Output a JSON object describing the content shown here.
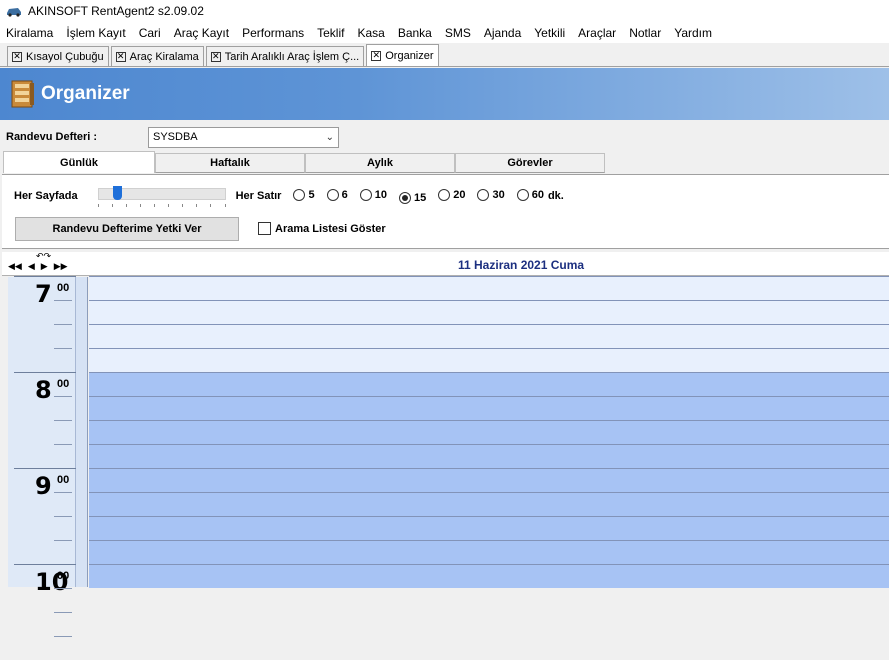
{
  "window": {
    "title": "AKINSOFT RentAgent2 s2.09.02"
  },
  "menu": [
    "Kiralama",
    "İşlem Kayıt",
    "Cari",
    "Araç Kayıt",
    "Performans",
    "Teklif",
    "Kasa",
    "Banka",
    "SMS",
    "Ajanda",
    "Yetkili",
    "Araçlar",
    "Notlar",
    "Yardım"
  ],
  "doc_tabs": [
    "Kısayol Çubuğu",
    "Araç Kiralama",
    "Tarih Aralıklı Araç İşlem Ç...",
    "Organizer"
  ],
  "header": {
    "title": "Organizer"
  },
  "defteri": {
    "label": "Randevu Defteri :",
    "value": "SYSDBA"
  },
  "view_tabs": [
    "Günlük",
    "Haftalık",
    "Aylık",
    "Görevler"
  ],
  "options": {
    "her_sayfada": "Her Sayfada",
    "her_satir": "Her Satır",
    "slider_level": 0.13,
    "intervals": [
      "5",
      "6",
      "10",
      "15",
      "20",
      "30",
      "60"
    ],
    "selected_interval": "15",
    "unit": "dk.",
    "yetki_button": "Randevu Defterime Yetki Ver",
    "arama_checkbox": "Arama Listesi Göster",
    "arama_checked": false
  },
  "calendar": {
    "date_label": "11 Haziran 2021 Cuma",
    "nav_top": "↶↷",
    "nav": [
      "◀◀",
      "◀",
      "▶",
      "▶▶"
    ],
    "hours": [
      {
        "hour": "7",
        "min": "00"
      },
      {
        "hour": "8",
        "min": "00"
      },
      {
        "hour": "9",
        "min": "00"
      },
      {
        "hour": "10",
        "min": "00"
      }
    ],
    "working_hours_start": "8:00"
  }
}
